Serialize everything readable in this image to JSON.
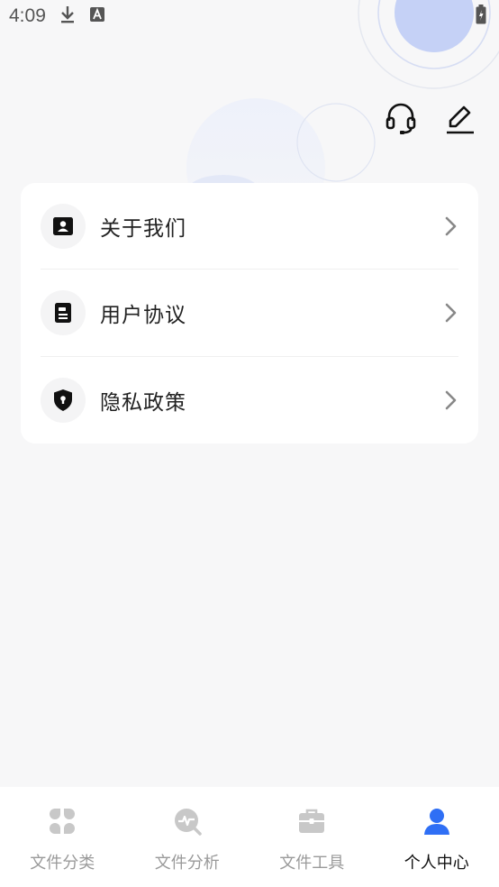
{
  "status_bar": {
    "time": "4:09",
    "icons": [
      "download-icon",
      "text-a-icon",
      "wifi-icon",
      "signal-icon",
      "battery-icon"
    ]
  },
  "header_actions": {
    "support_icon": "headset-icon",
    "edit_icon": "edit-pen-icon"
  },
  "menu": {
    "items": [
      {
        "label": "关于我们",
        "icon": "contact-card-icon"
      },
      {
        "label": "用户协议",
        "icon": "document-icon"
      },
      {
        "label": "隐私政策",
        "icon": "shield-icon"
      }
    ]
  },
  "tabs": [
    {
      "label": "文件分类",
      "icon": "category-icon",
      "active": false
    },
    {
      "label": "文件分析",
      "icon": "analysis-icon",
      "active": false
    },
    {
      "label": "文件工具",
      "icon": "toolbox-icon",
      "active": false
    },
    {
      "label": "个人中心",
      "icon": "user-icon",
      "active": true
    }
  ],
  "colors": {
    "background": "#f7f7f8",
    "card": "#ffffff",
    "active_tab_icon": "#2f6ff5",
    "inactive_tab": "#c8c8c8",
    "decor_blue": "#c7d3f5"
  }
}
